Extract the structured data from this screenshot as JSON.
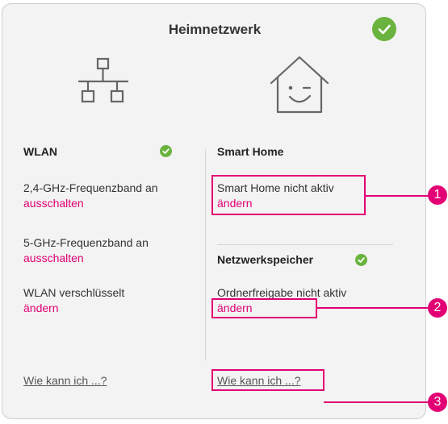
{
  "header": {
    "title": "Heimnetzwerk",
    "status_icon": "check-circle-icon"
  },
  "wlan": {
    "heading": "WLAN",
    "items": [
      {
        "status": "2,4-GHz-Frequenzband an",
        "action": "ausschalten"
      },
      {
        "status": "5-GHz-Frequenzband an",
        "action": "ausschalten"
      },
      {
        "status": "WLAN verschlüsselt",
        "action": "ändern"
      }
    ],
    "help_link": "Wie kann ich ...?"
  },
  "smart_home": {
    "heading": "Smart Home",
    "status": "Smart Home nicht aktiv",
    "action": "ändern"
  },
  "storage": {
    "heading": "Netzwerkspeicher",
    "status": "Ordnerfreigabe nicht aktiv",
    "action": "ändern",
    "help_link": "Wie kann ich ...?"
  },
  "callouts": [
    "1",
    "2",
    "3"
  ],
  "colors": {
    "accent": "#e20074",
    "ok": "#6ab33e",
    "panel_bg": "#f3f3f3"
  }
}
